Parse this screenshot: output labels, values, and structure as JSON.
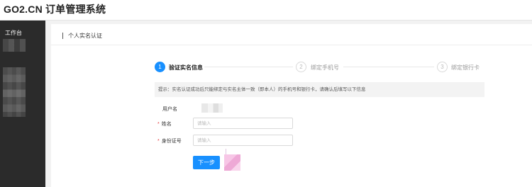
{
  "app": {
    "brand": "GO2.CN 订单管理系统"
  },
  "sidebar": {
    "title": "工作台"
  },
  "panel": {
    "title": "个人实名认证"
  },
  "steps": [
    {
      "number": "1",
      "label": "验证实名信息",
      "active": true
    },
    {
      "number": "2",
      "label": "绑定手机号",
      "active": false
    },
    {
      "number": "3",
      "label": "绑定银行卡",
      "active": false
    }
  ],
  "notice": "提示：实名认证成功后只能绑定与实名主体一致（即本人）的手机号和银行卡，请确认后填写以下信息",
  "form": {
    "username_label": "用户名",
    "name_label": "姓名",
    "name_placeholder": "请输入",
    "id_label": "身份证号",
    "id_placeholder": "请输入",
    "required_mark": "*"
  },
  "actions": {
    "next_label": "下一步"
  },
  "colors": {
    "primary": "#1890ff",
    "sidebar": "#2b2b2b",
    "required": "#e4393c"
  }
}
